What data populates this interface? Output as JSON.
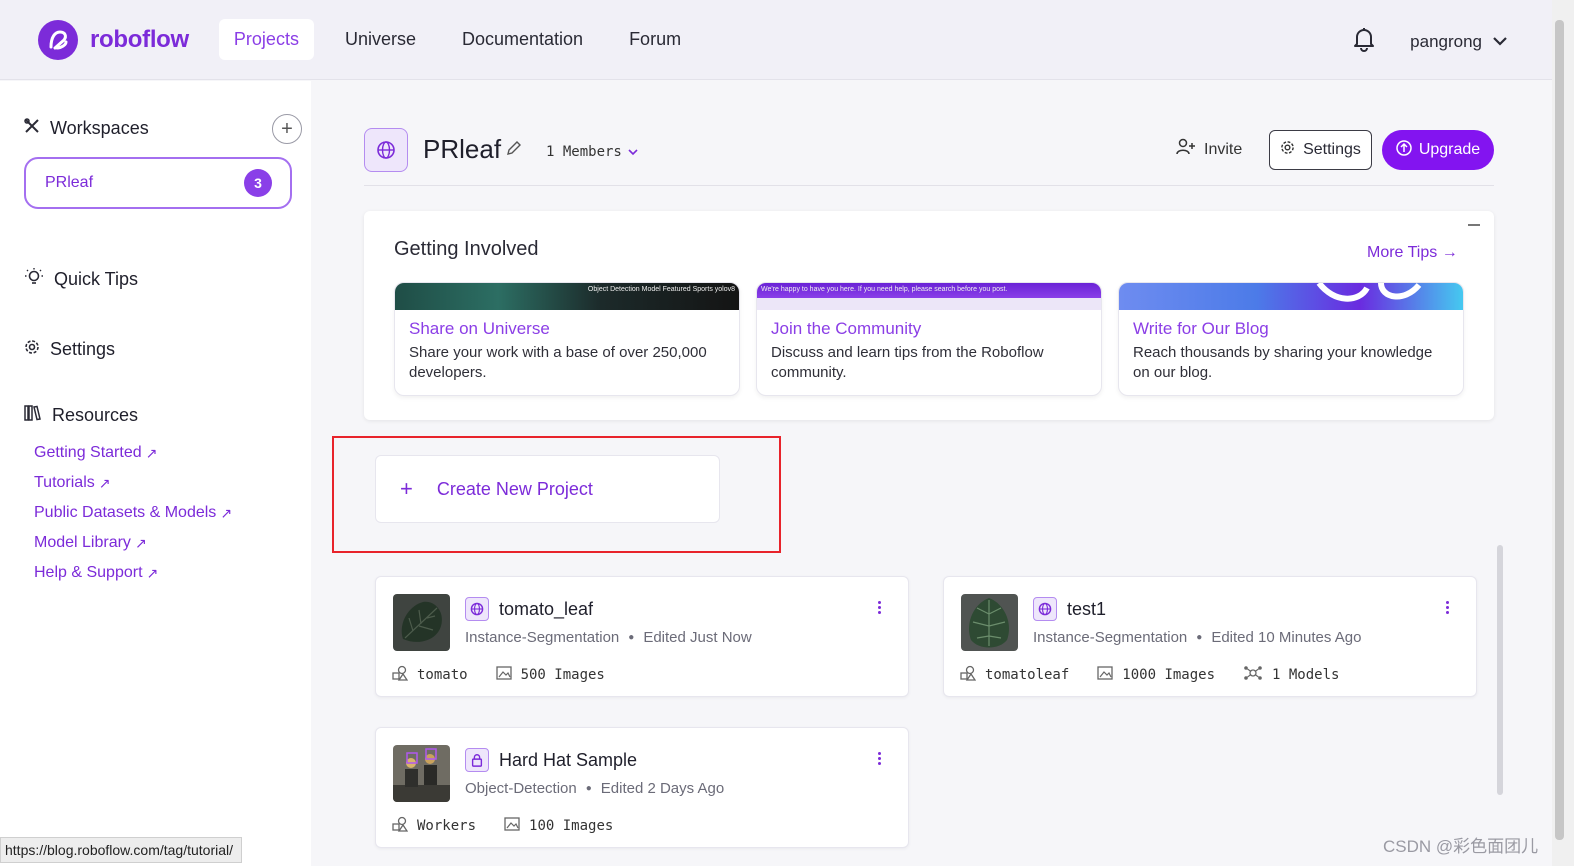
{
  "brand": {
    "name": "roboflow",
    "color": "#7c2bd9"
  },
  "nav": {
    "items": [
      {
        "label": "Projects",
        "active": true
      },
      {
        "label": "Universe",
        "active": false
      },
      {
        "label": "Documentation",
        "active": false
      },
      {
        "label": "Forum",
        "active": false
      }
    ],
    "user": "pangrong"
  },
  "sidebar": {
    "workspaces_label": "Workspaces",
    "workspace": {
      "name": "PRleaf",
      "badge": "3"
    },
    "quick_tips_label": "Quick Tips",
    "settings_label": "Settings",
    "resources_label": "Resources",
    "resources": [
      {
        "label": "Getting Started"
      },
      {
        "label": "Tutorials"
      },
      {
        "label": "Public Datasets & Models"
      },
      {
        "label": "Model Library"
      },
      {
        "label": "Help & Support"
      }
    ]
  },
  "workspace_header": {
    "title": "PRleaf",
    "members": "1 Members",
    "invite": "Invite",
    "settings": "Settings",
    "upgrade": "Upgrade"
  },
  "getting_involved": {
    "title": "Getting Involved",
    "more_tips": "More Tips",
    "cards": [
      {
        "title": "Share on Universe",
        "desc": "Share your work with a base of over 250,000 developers.",
        "banner_text": "Object Detection   Model   Featured   Sports   yolov8"
      },
      {
        "title": "Join the Community",
        "desc": "Discuss and learn tips from the Roboflow community.",
        "banner_text": "We're happy to have you here. If you need help, please search before you post."
      },
      {
        "title": "Write for Our Blog",
        "desc": "Reach thousands by sharing your knowledge on our blog.",
        "banner_text": ""
      }
    ]
  },
  "create_project": {
    "label": "Create New Project"
  },
  "projects": [
    {
      "name": "tomato_leaf",
      "type": "Instance-Segmentation",
      "edited": "Edited Just Now",
      "class": "tomato",
      "images": "500 Images",
      "models": "",
      "visibility": "public"
    },
    {
      "name": "test1",
      "type": "Instance-Segmentation",
      "edited": "Edited 10 Minutes Ago",
      "class": "tomatoleaf",
      "images": "1000 Images",
      "models": "1 Models",
      "visibility": "public"
    },
    {
      "name": "Hard Hat Sample",
      "type": "Object-Detection",
      "edited": "Edited 2 Days Ago",
      "class": "Workers",
      "images": "100 Images",
      "models": "",
      "visibility": "private"
    }
  ],
  "status_bar": {
    "url": "https://blog.roboflow.com/tag/tutorial/"
  },
  "watermark": "CSDN @彩色面团儿"
}
